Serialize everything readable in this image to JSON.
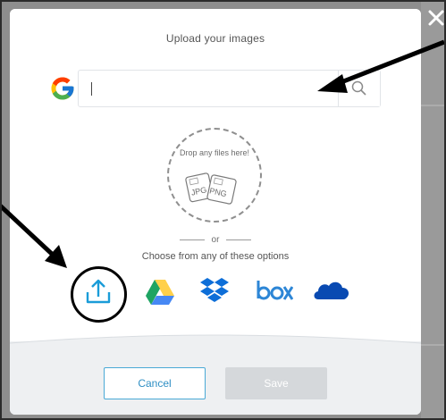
{
  "modal": {
    "title": "Upload your images",
    "search": {
      "value": "",
      "placeholder": ""
    },
    "drop_zone": {
      "text": "Drop any files here!",
      "file_badges": [
        "JPG",
        "PNG"
      ]
    },
    "divider_text": "or",
    "choose_text": "Choose from any of these options",
    "sources": [
      "upload-icon",
      "google-drive-icon",
      "dropbox-icon",
      "box-icon",
      "onedrive-icon"
    ],
    "buttons": {
      "cancel": "Cancel",
      "save": "Save"
    }
  },
  "annotations": {
    "arrow_color": "#000000",
    "circle_highlight": "upload-icon"
  },
  "colors": {
    "upload_blue": "#1a9cd8",
    "drive_green": "#1fa463",
    "drive_yellow": "#ffd04b",
    "drive_blue": "#4688f4",
    "dropbox_blue": "#0d6ed8",
    "box_blue": "#2d86d6",
    "onedrive_blue": "#094ab2",
    "cancel_border": "#49a9d6",
    "save_disabled": "#d5d8db"
  }
}
